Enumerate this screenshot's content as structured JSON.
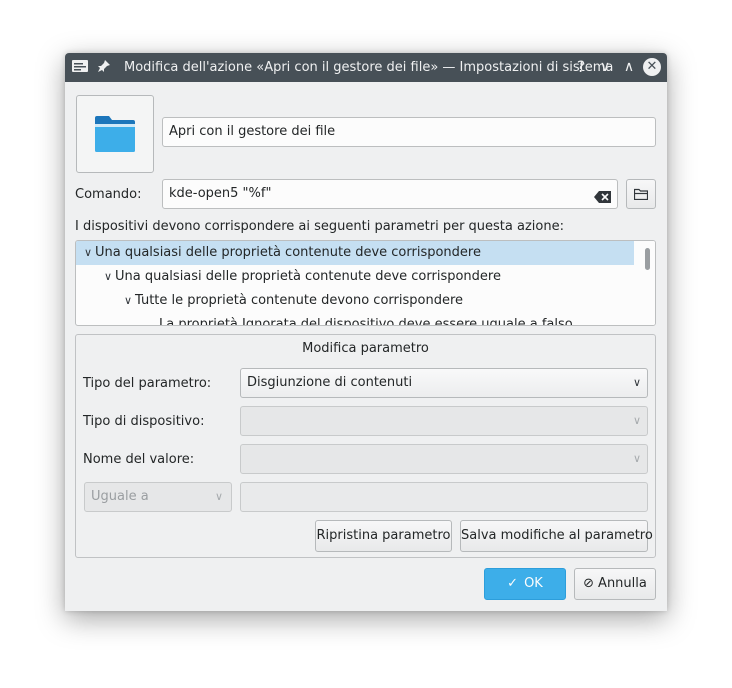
{
  "window": {
    "title": "Modifica dell'azione «Apri con il gestore dei file» — Impostazioni di sistema",
    "help_glyph": "?",
    "minimize_glyph": "∨",
    "maximize_glyph": "∧",
    "close_glyph": "✕"
  },
  "action": {
    "icon": "folder-icon",
    "name_value": "Apri con il gestore dei file",
    "command_label": "Comando:",
    "command_value": "kde-open5 \"%f\""
  },
  "devices_label": "I dispositivi devono corrispondere ai seguenti parametri per questa azione:",
  "tree": {
    "rows": [
      {
        "label": "Una qualsiasi delle proprietà contenute deve corrispondere"
      },
      {
        "label": "Una qualsiasi delle proprietà contenute deve corrispondere"
      },
      {
        "label": "Tutte le proprietà contenute devono corrispondere"
      },
      {
        "label": "La proprietà Ignorata del dispositivo deve essere uguale a falso"
      }
    ]
  },
  "edit": {
    "title": "Modifica parametro",
    "param_type_label": "Tipo del parametro:",
    "param_type_value": "Disgiunzione di contenuti",
    "device_type_label": "Tipo di dispositivo:",
    "value_name_label": "Nome del valore:",
    "compare_value": "Uguale a",
    "reset_button": "Ripristina parametro",
    "save_button": "Salva modifiche al parametro"
  },
  "buttons": {
    "ok": "OK",
    "cancel": "Annulla"
  },
  "colors": {
    "titlebar": "#475057",
    "accent": "#3daee9",
    "selection": "#c5dff2",
    "window_bg": "#eff0f1"
  }
}
